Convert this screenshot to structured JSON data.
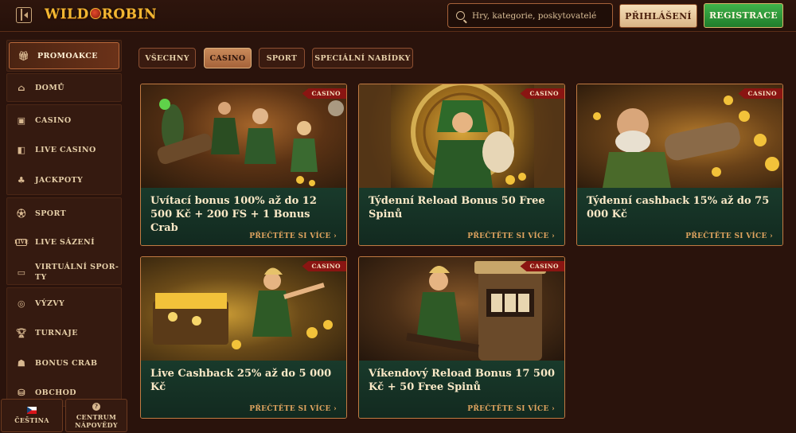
{
  "header": {
    "logo_text": "WILD ROBIN",
    "search_placeholder": "Hry, kategorie, poskytovatelé",
    "login_label": "PŘIHLÁŠENÍ",
    "register_label": "REGISTRACE"
  },
  "sidebar": {
    "items": [
      {
        "label": "PROMOAKCE",
        "icon": "gift-icon"
      },
      {
        "label": "DOMŮ",
        "icon": "home-icon"
      },
      {
        "label": "CASINO",
        "icon": "slot-machine-icon"
      },
      {
        "label": "LIVE CASINO",
        "icon": "dealer-icon"
      },
      {
        "label": "JACKPOTY",
        "icon": "clover-icon"
      },
      {
        "label": "SPORT",
        "icon": "ball-icon"
      },
      {
        "label": "LIVE SÁZENÍ",
        "icon": "live-badge-icon"
      },
      {
        "label": "VIRTUÁLNÍ SPOR-",
        "label2": "TY",
        "icon": "virtual-icon"
      },
      {
        "label": "VÝZVY",
        "icon": "target-icon"
      },
      {
        "label": "TURNAJE",
        "icon": "trophy-icon"
      },
      {
        "label": "BONUS CRAB",
        "icon": "crab-icon"
      },
      {
        "label": "OBCHOD",
        "icon": "bag-icon"
      }
    ],
    "language_label": "ČEŠTINA",
    "help_label_1": "CENTRUM",
    "help_label_2": "NÁPOVĚDY"
  },
  "filters": [
    "VŠECHNY",
    "CASINO",
    "SPORT",
    "SPECIÁLNÍ NABÍDKY"
  ],
  "active_filter": "CASINO",
  "cards": [
    {
      "tag": "CASINO",
      "title": "Uvítací bonus 100% až do 12 500 Kč + 200 FS + 1 Bonus Crab",
      "link": "PŘEČTĚTE SI VÍCE"
    },
    {
      "tag": "CASINO",
      "title": "Týdenní Reload Bonus 50 Free Spinů",
      "link": "PŘEČTĚTE SI VÍCE"
    },
    {
      "tag": "CASINO",
      "title": "Týdenní cashback 15% až do 75 000 Kč",
      "link": "PŘEČTĚTE SI VÍCE"
    },
    {
      "tag": "CASINO",
      "title": "Live Cashback 25% až do 5 000 Kč",
      "link": "PŘEČTĚTE SI VÍCE"
    },
    {
      "tag": "CASINO",
      "title": "Víkendový Reload Bonus 17 500 Kč + 50 Free Spinů",
      "link": "PŘEČTĚTE SI VÍCE"
    }
  ],
  "colors": {
    "background": "#2a130c",
    "card_body": "#193a2b",
    "accent": "#c17a42",
    "register": "#2e9a3a",
    "tag": "#8a1512"
  }
}
